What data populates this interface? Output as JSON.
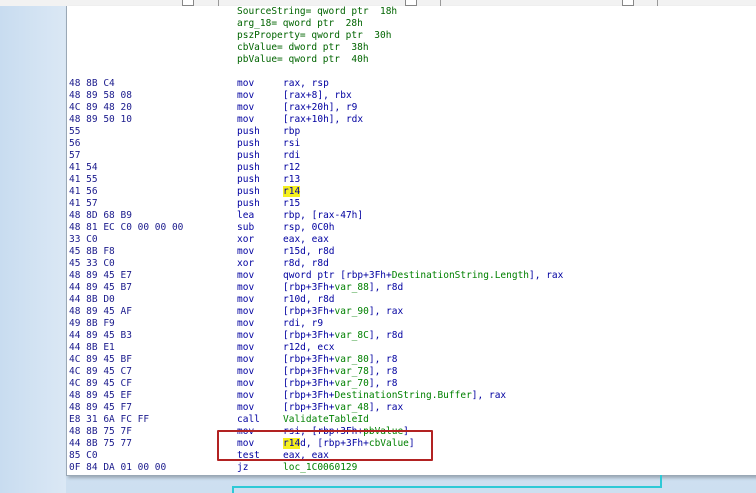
{
  "vars": [
    {
      "name": "SourceString",
      "decl": "= qword ptr  18h"
    },
    {
      "name": "arg_18",
      "decl": "= qword ptr  28h"
    },
    {
      "name": "pszProperty",
      "decl": "= qword ptr  30h"
    },
    {
      "name": "cbValue",
      "decl": "= dword ptr  38h"
    },
    {
      "name": "pbValue",
      "decl": "= qword ptr  40h"
    }
  ],
  "instructions": [
    {
      "bytes": "48 8B C4",
      "mnem": "mov",
      "ops": "rax, rsp"
    },
    {
      "bytes": "48 89 58 08",
      "mnem": "mov",
      "ops": "[rax+8], rbx"
    },
    {
      "bytes": "4C 89 48 20",
      "mnem": "mov",
      "ops": "[rax+20h], r9"
    },
    {
      "bytes": "48 89 50 10",
      "mnem": "mov",
      "ops": "[rax+10h], rdx"
    },
    {
      "bytes": "55",
      "mnem": "push",
      "ops": "rbp"
    },
    {
      "bytes": "56",
      "mnem": "push",
      "ops": "rsi"
    },
    {
      "bytes": "57",
      "mnem": "push",
      "ops": "rdi"
    },
    {
      "bytes": "41 54",
      "mnem": "push",
      "ops": "r12"
    },
    {
      "bytes": "41 55",
      "mnem": "push",
      "ops": "r13"
    },
    {
      "bytes": "41 56",
      "mnem": "push",
      "ops": "r14"
    },
    {
      "bytes": "41 57",
      "mnem": "push",
      "ops": "r15"
    },
    {
      "bytes": "48 8D 68 B9",
      "mnem": "lea",
      "ops": "rbp, [rax-47h]"
    },
    {
      "bytes": "48 81 EC C0 00 00 00",
      "mnem": "sub",
      "ops": "rsp, 0C0h"
    },
    {
      "bytes": "33 C0",
      "mnem": "xor",
      "ops": "eax, eax"
    },
    {
      "bytes": "45 8B F8",
      "mnem": "mov",
      "ops": "r15d, r8d"
    },
    {
      "bytes": "45 33 C0",
      "mnem": "xor",
      "ops": "r8d, r8d"
    },
    {
      "bytes": "48 89 45 E7",
      "mnem": "mov",
      "ops": "qword ptr [rbp+3Fh+DestinationString.Length], rax"
    },
    {
      "bytes": "44 89 45 B7",
      "mnem": "mov",
      "ops": "[rbp+3Fh+var_88], r8d"
    },
    {
      "bytes": "44 8B D0",
      "mnem": "mov",
      "ops": "r10d, r8d"
    },
    {
      "bytes": "48 89 45 AF",
      "mnem": "mov",
      "ops": "[rbp+3Fh+var_90], rax"
    },
    {
      "bytes": "49 8B F9",
      "mnem": "mov",
      "ops": "rdi, r9"
    },
    {
      "bytes": "44 89 45 B3",
      "mnem": "mov",
      "ops": "[rbp+3Fh+var_8C], r8d"
    },
    {
      "bytes": "44 8B E1",
      "mnem": "mov",
      "ops": "r12d, ecx"
    },
    {
      "bytes": "4C 89 45 BF",
      "mnem": "mov",
      "ops": "[rbp+3Fh+var_80], r8"
    },
    {
      "bytes": "4C 89 45 C7",
      "mnem": "mov",
      "ops": "[rbp+3Fh+var_78], r8"
    },
    {
      "bytes": "4C 89 45 CF",
      "mnem": "mov",
      "ops": "[rbp+3Fh+var_70], r8"
    },
    {
      "bytes": "48 89 45 EF",
      "mnem": "mov",
      "ops": "[rbp+3Fh+DestinationString.Buffer], rax"
    },
    {
      "bytes": "48 89 45 F7",
      "mnem": "mov",
      "ops": "[rbp+3Fh+var_48], rax"
    },
    {
      "bytes": "E8 31 6A FC FF",
      "mnem": "call",
      "ops": "ValidateTableId"
    },
    {
      "bytes": "48 8B 75 7F",
      "mnem": "mov",
      "ops": "rsi, [rbp+3Fh+pbValue]"
    },
    {
      "bytes": "44 8B 75 77",
      "mnem": "mov",
      "ops": "r14d, [rbp+3Fh+cbValue]"
    },
    {
      "bytes": "85 C0",
      "mnem": "test",
      "ops": "eax, eax"
    },
    {
      "bytes": "0F 84 DA 01 00 00",
      "mnem": "jz",
      "ops": "loc_1C0060129"
    }
  ],
  "highlight_register": "r14",
  "colors": {
    "highlight": "#f5f01e",
    "annotation_box": "#b22222",
    "flow_arrow": "#2ec9d6",
    "code_text": "#0000a0",
    "symbol_text": "#008000"
  }
}
